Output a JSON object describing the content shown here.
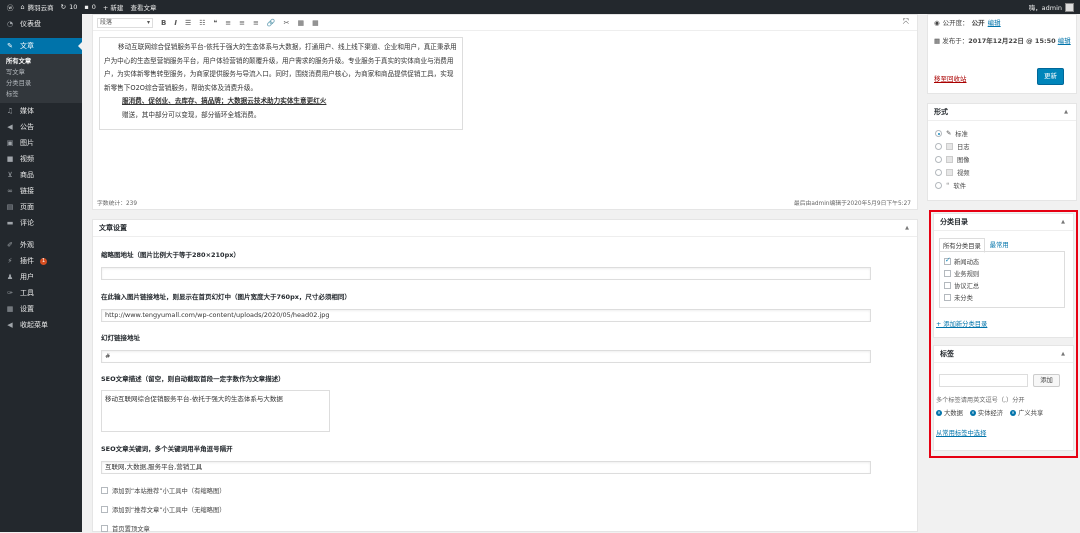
{
  "adminbar": {
    "wp": "ⓦ",
    "site": "腾羽云商",
    "updates": "10",
    "comments": "0",
    "new": "+ 新建",
    "view": "查看文章",
    "greet": "嗨，admin"
  },
  "menu": {
    "dashboard": "仪表盘",
    "posts": "文章",
    "posts_sub": [
      "所有文章",
      "写文章",
      "分类目录",
      "标签"
    ],
    "media": "媒体",
    "notice": "公告",
    "images": "图片",
    "video": "视频",
    "goods": "商品",
    "links": "链接",
    "pages": "页面",
    "comments": "评论",
    "appearance": "外观",
    "plugins": "插件",
    "plugins_badge": "1",
    "users": "用户",
    "tools": "工具",
    "settings": "设置",
    "collapse": "收起菜单"
  },
  "editor": {
    "format": "段落",
    "toolbar": [
      "B",
      "I",
      "☰",
      "☷",
      "❝",
      "≡",
      "≡",
      "≡",
      "🔗",
      "✂",
      "▦",
      "▦"
    ],
    "p1": "移动互联网综合促销服务平台-依托于强大的生态体系与大数据，打通用户、线上线下渠道、企业和用户，真正秉承用户为中心的生态型营销服务平台，用户体验营销的颠覆升级，用户需求的服务升级。专业服务于真实的实体商业与消费用户，为实体新零售转型服务，为商家提供服务与导流入口。同时，围绕消费用户核心，为商家和商品提供促销工具，实现新零售下O2O综合营销服务，帮助实体及消费升级。",
    "p2": "服消费、促创业、去库存、搞品牌；大数据云技术助力实体生意更红火",
    "p3": "赠送，其中部分可以变现，部分循环全城消费。",
    "word_count": "字数统计：239",
    "last_edit": "最后由admin编辑于2020年5月9日下午5:27"
  },
  "settings": {
    "title": "文章设置",
    "f1_label": "缩略图地址（图片比例大于等于280×210px）",
    "f1_value": "",
    "f2_label": "在此输入图片链接地址，则显示在首页幻灯中（图片宽度大于760px，尺寸必须相同）",
    "f2_value": "http://www.tengyumall.com/wp-content/uploads/2020/05/head02.jpg",
    "f3_label": "幻灯链接地址",
    "f3_value": "#",
    "f4_label": "SEO文章描述（留空，则自动截取首段一定字数作为文章描述）",
    "f4_value": "移动互联网综合促销服务平台-依托于强大的生态体系与大数据",
    "f5_label": "SEO文章关键词，多个关键词用半角逗号隔开",
    "f5_value": "互联网,大数据,服务平台,营销工具",
    "cb1": "添加到“本站推荐”小工具中（有缩略图）",
    "cb2": "添加到“推荐文章”小工具中（无缩略图）",
    "cb3": "首页置顶文章"
  },
  "publish": {
    "visibility_label": "公开度：",
    "visibility": "公开",
    "edit1": "编辑",
    "published_label": "发布于：",
    "published": "2017年12月22日 @ 15:50",
    "edit2": "编辑",
    "trash": "移至回收站",
    "update": "更新"
  },
  "format": {
    "title": "形式",
    "options": [
      "标准",
      "日志",
      "图像",
      "视频",
      "软件"
    ],
    "selected": "标准"
  },
  "category": {
    "title": "分类目录",
    "tab_all": "所有分类目录",
    "tab_used": "最常用",
    "items": [
      "新闻动态",
      "业务规则",
      "协议汇总",
      "未分类"
    ],
    "checked": "新闻动态",
    "add": "+ 添加新分类目录"
  },
  "tags": {
    "title": "标签",
    "add": "添加",
    "hint": "多个标签请用英文逗号（,）分开",
    "items": [
      "大数据",
      "实体经济",
      "广义共享"
    ],
    "choose": "从常用标签中选择"
  },
  "colors": {
    "highlight": "#e60012",
    "accent": "#0073aa",
    "menubar": "#23282d"
  }
}
